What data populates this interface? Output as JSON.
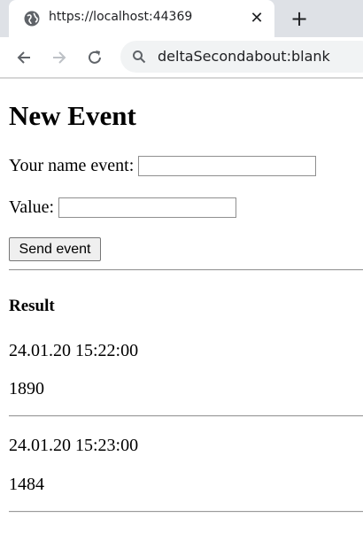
{
  "browser": {
    "tab_title": "https://localhost:44369",
    "tab_favicon": "globe-icon",
    "address": "deltaSecondabout:blank"
  },
  "page": {
    "heading": "New Event",
    "name_label": "Your name event:",
    "name_value": "",
    "value_label": "Value:",
    "value_value": "",
    "send_label": "Send event",
    "result_title": "Result",
    "results": [
      {
        "timestamp": "24.01.20 15:22:00",
        "value": "1890"
      },
      {
        "timestamp": "24.01.20 15:23:00",
        "value": "1484"
      }
    ]
  }
}
